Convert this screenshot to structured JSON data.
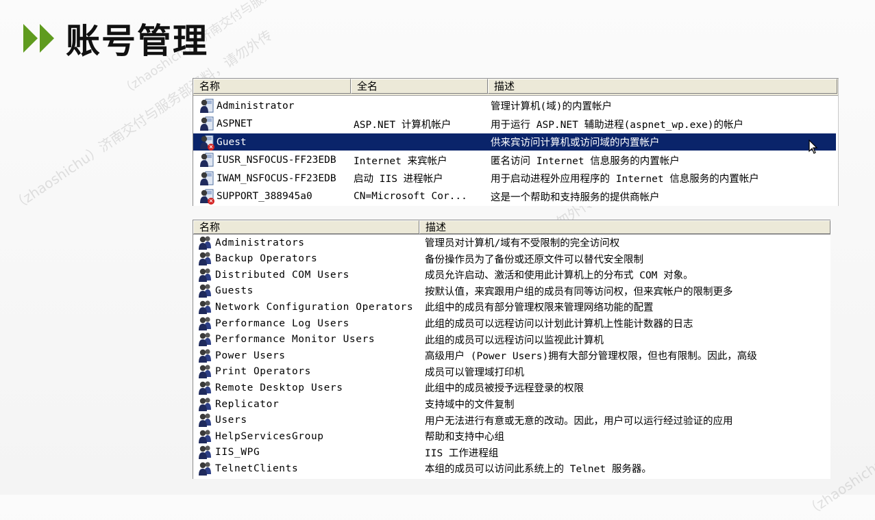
{
  "slide": {
    "title": "账号管理"
  },
  "watermarks": [
    "（zhaoshichu）济南交付与服务部资料，请勿外传",
    "赵世初（zhaoshichu）济南交付内部资料，请勿外传",
    "（zhaoshichu）济南交付与服务部资料，请勿外传",
    "（zhaoshichu）济南"
  ],
  "users_panel": {
    "columns": [
      "名称",
      "全名",
      "描述"
    ],
    "rows": [
      {
        "name": "Administrator",
        "full_name": "",
        "description": "管理计算机(域)的内置帐户",
        "icon": "user-icon",
        "disabled": false,
        "selected": false
      },
      {
        "name": "ASPNET",
        "full_name": "ASP.NET 计算机帐户",
        "description": "用于运行 ASP.NET 辅助进程(aspnet_wp.exe)的帐户",
        "icon": "user-icon",
        "disabled": false,
        "selected": false
      },
      {
        "name": "Guest",
        "full_name": "",
        "description": "供来宾访问计算机或访问域的内置帐户",
        "icon": "user-disabled-icon",
        "disabled": true,
        "selected": true
      },
      {
        "name": "IUSR_NSFOCUS-FF23EDB",
        "full_name": "Internet 来宾帐户",
        "description": "匿名访问 Internet 信息服务的内置帐户",
        "icon": "user-icon",
        "disabled": false,
        "selected": false
      },
      {
        "name": "IWAM_NSFOCUS-FF23EDB",
        "full_name": "启动 IIS 进程帐户",
        "description": "用于启动进程外应用程序的 Internet 信息服务的内置帐户",
        "icon": "user-icon",
        "disabled": false,
        "selected": false
      },
      {
        "name": "SUPPORT_388945a0",
        "full_name": "CN=Microsoft Cor...",
        "description": "这是一个帮助和支持服务的提供商帐户",
        "icon": "user-disabled-icon",
        "disabled": true,
        "selected": false
      }
    ]
  },
  "groups_panel": {
    "columns": [
      "名称",
      "描述"
    ],
    "rows": [
      {
        "name": "Administrators",
        "description": "管理员对计算机/域有不受限制的完全访问权"
      },
      {
        "name": "Backup Operators",
        "description": "备份操作员为了备份或还原文件可以替代安全限制"
      },
      {
        "name": "Distributed COM Users",
        "description": "成员允许启动、激活和使用此计算机上的分布式 COM 对象。"
      },
      {
        "name": "Guests",
        "description": "按默认值，来宾跟用户组的成员有同等访问权，但来宾帐户的限制更多"
      },
      {
        "name": "Network Configuration Operators",
        "description": "此组中的成员有部分管理权限来管理网络功能的配置"
      },
      {
        "name": "Performance Log Users",
        "description": "此组的成员可以远程访问以计划此计算机上性能计数器的日志"
      },
      {
        "name": "Performance Monitor Users",
        "description": "此组的成员可以远程访问以监视此计算机"
      },
      {
        "name": "Power Users",
        "description": "高级用户 (Power Users)拥有大部分管理权限，但也有限制。因此，高级"
      },
      {
        "name": "Print Operators",
        "description": "成员可以管理域打印机"
      },
      {
        "name": "Remote Desktop Users",
        "description": "此组中的成员被授予远程登录的权限"
      },
      {
        "name": "Replicator",
        "description": "支持域中的文件复制"
      },
      {
        "name": "Users",
        "description": "用户无法进行有意或无意的改动。因此，用户可以运行经过验证的应用"
      },
      {
        "name": "HelpServicesGroup",
        "description": "帮助和支持中心组"
      },
      {
        "name": "IIS_WPG",
        "description": "IIS 工作进程组"
      },
      {
        "name": "TelnetClients",
        "description": "本组的成员可以访问此系统上的 Telnet 服务器。"
      }
    ]
  },
  "colors": {
    "accent_arrow": "#5f9b1e",
    "selection": "#0a246a",
    "disabled_mark": "#d42424"
  }
}
